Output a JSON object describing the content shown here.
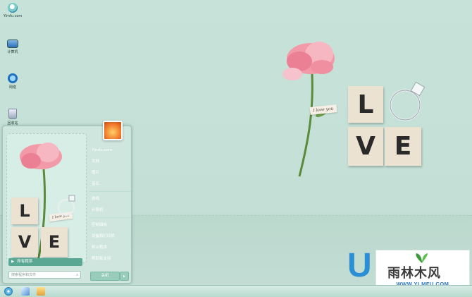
{
  "desktop_icons": [
    {
      "label": "Ylmfu.com",
      "icon": "globe-user-icon"
    },
    {
      "label": "计算机",
      "icon": "computer-icon"
    },
    {
      "label": "网络",
      "icon": "network-icon"
    },
    {
      "label": "回收站",
      "icon": "recycle-bin-icon"
    }
  ],
  "wallpaper": {
    "tag_text": "I love you",
    "letters": [
      "L",
      "O",
      "V",
      "E"
    ]
  },
  "start_menu": {
    "right_items": [
      {
        "label": "Ylmfu.com"
      },
      {
        "label": "文档"
      },
      {
        "label": "图片"
      },
      {
        "label": "音乐"
      },
      {
        "sep": true
      },
      {
        "label": "游戏"
      },
      {
        "label": "计算机"
      },
      {
        "sep": true
      },
      {
        "label": "控制面板"
      },
      {
        "label": "设备和打印机"
      },
      {
        "label": "默认程序"
      },
      {
        "label": "帮助和支持"
      }
    ],
    "all_programs": "所有程序",
    "search_placeholder": "搜索程序和文件",
    "shutdown": "关机",
    "art": {
      "letters": [
        "L",
        "V",
        "E"
      ],
      "tag_text": "I love you"
    }
  },
  "watermark": {
    "brand": "雨林木风",
    "url": "WWW.YLMFU.COM",
    "logo_letter": "U"
  },
  "colors": {
    "accent": "#5aa794",
    "bg": "#c7e2d9"
  }
}
